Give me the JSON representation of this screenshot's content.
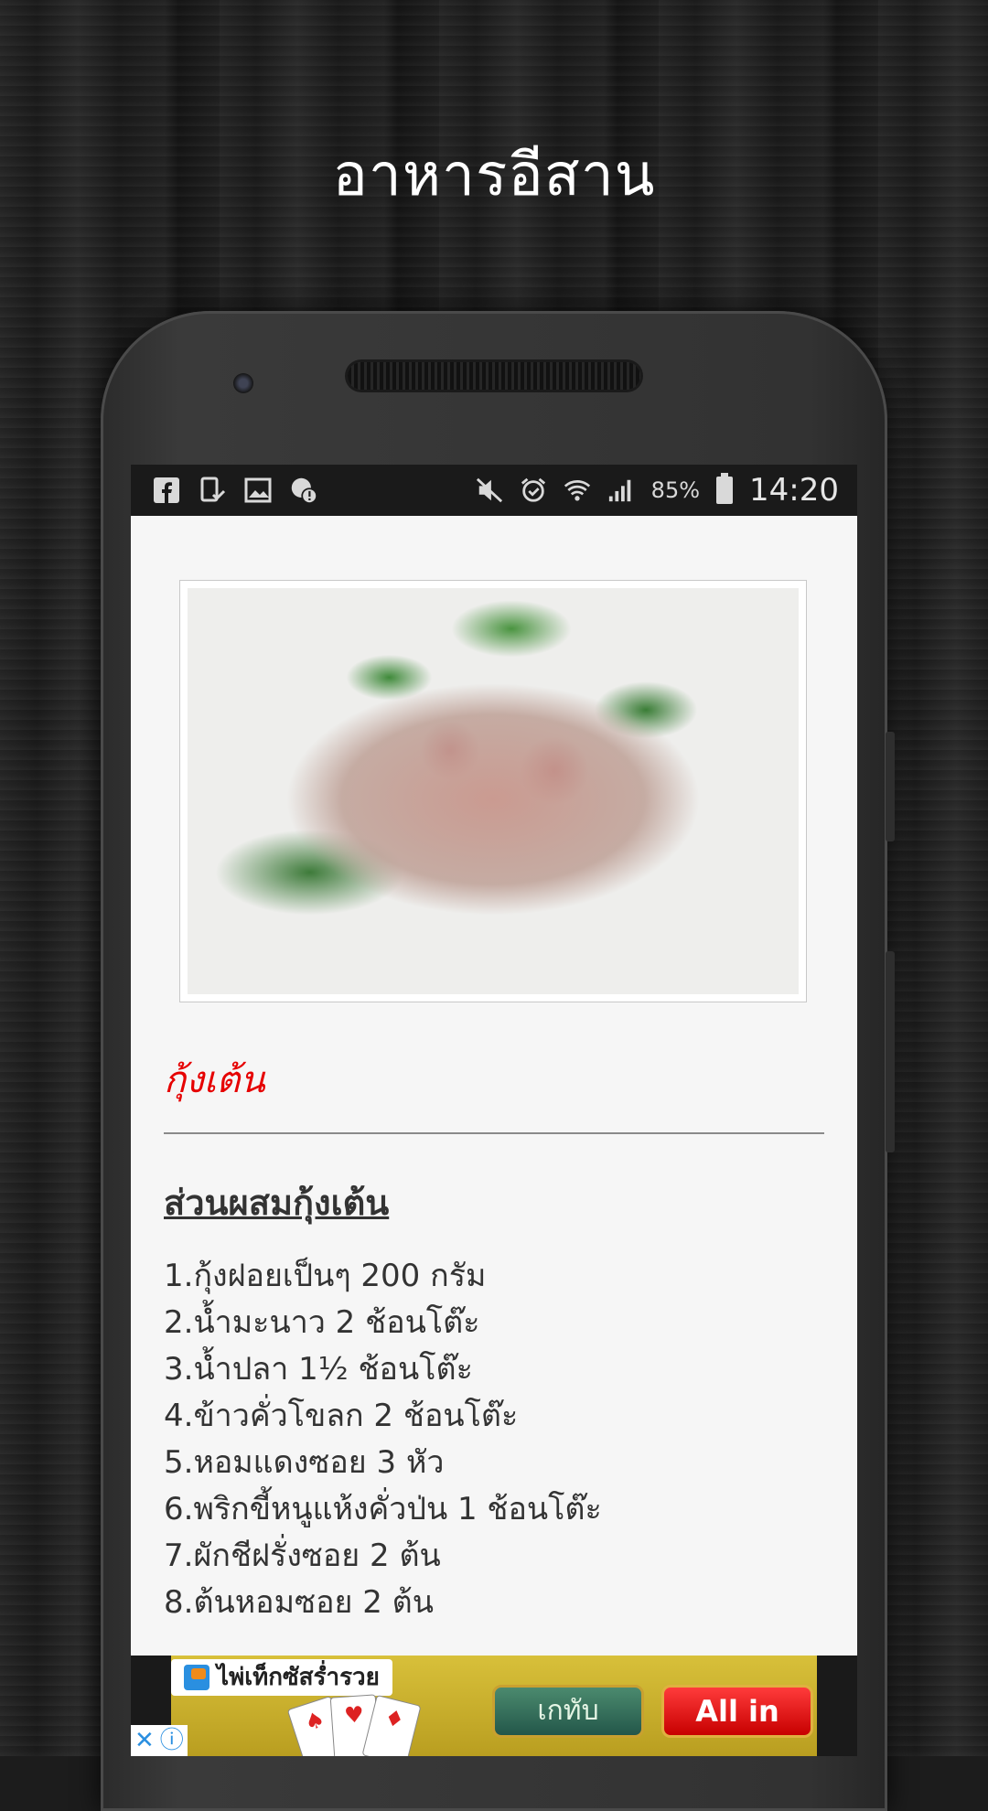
{
  "page": {
    "title": "อาหารอีสาน"
  },
  "statusbar": {
    "left_icons": [
      "facebook-icon",
      "phone-check-icon",
      "image-icon",
      "notification-alert-icon"
    ],
    "right_icons": [
      "mute-icon",
      "alarm-icon",
      "wifi-icon",
      "signal-icon"
    ],
    "battery_percent": "85%",
    "time": "14:20"
  },
  "recipe": {
    "name": "กุ้งเต้น",
    "ingredients_heading": "ส่วนผสมกุ้งเต้น",
    "ingredients": [
      "1.กุ้งฝอยเป็นๆ 200 กรัม",
      "2.น้ำมะนาว 2 ช้อนโต๊ะ",
      "3.น้ำปลา 1½ ช้อนโต๊ะ",
      "4.ข้าวคั่วโขลก 2 ช้อนโต๊ะ",
      "5.หอมแดงซอย 3 หัว",
      "6.พริกขี้หนูแห้งคั่วป่น 1 ช้อนโต๊ะ",
      "7.ผักชีฝรั่งซอย 2 ต้น",
      "8.ต้นหอมซอย 2 ต้น"
    ]
  },
  "ad": {
    "tag_text": "ไพ่เท็กซัสร่ำรวย",
    "back_button": "เกทับ",
    "allin_button": "All in",
    "choices_close": "✕",
    "choices_info": "ⓘ"
  }
}
